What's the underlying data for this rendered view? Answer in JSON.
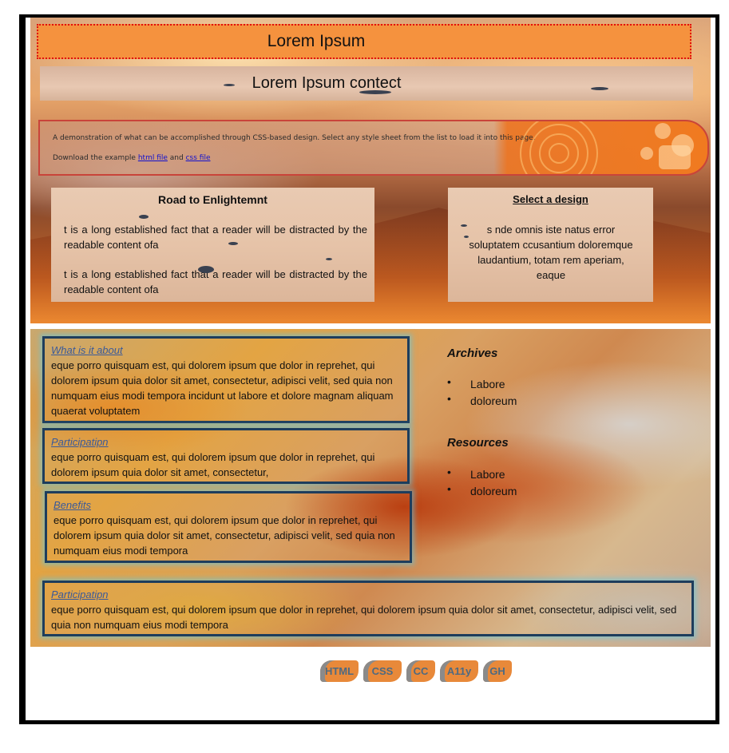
{
  "header": {
    "title": "Lorem Ipsum",
    "subtitle": "Lorem Ipsum contect"
  },
  "demo": {
    "line1": "A demonstration of what can be accomplished through CSS-based design. Select any style sheet from the list to load it into this page.",
    "download_prefix": "Download the example",
    "html_link": "html file",
    "and": "and",
    "css_link": "css file"
  },
  "road": {
    "title": "Road to Enlightemnt",
    "para1": "t is a long established fact that a reader will be distracted by the readable content ofa",
    "para2": "t is a long established fact that a reader will be distracted by the readable content ofa"
  },
  "select": {
    "title": "Select a design",
    "text": "s nde omnis iste natus error soluptatem ccusantium doloremque laudantium, totam rem aperiam, eaque"
  },
  "sections": [
    {
      "heading": "What is it about",
      "text": "eque porro quisquam est, qui dolorem ipsum que dolor in reprehet, qui dolorem ipsum quia dolor sit amet, consectetur, adipisci velit, sed quia non numquam eius modi tempora incidunt ut labore et dolore magnam aliquam quaerat voluptatem"
    },
    {
      "heading": "Participatipn",
      "text": "eque porro quisquam est, qui dolorem ipsum que dolor in reprehet, qui dolorem ipsum quia dolor sit amet, consectetur,"
    },
    {
      "heading": "Benefits",
      "text": "eque porro quisquam est, qui dolorem ipsum que dolor in reprehet, qui dolorem ipsum quia dolor sit amet, consectetur, adipisci velit, sed quia non numquam eius modi tempora"
    },
    {
      "heading": "Participatipn",
      "text": "eque porro quisquam est, qui dolorem ipsum que dolor in reprehet, qui dolorem ipsum quia dolor sit amet, consectetur, adipisci velit, sed quia non numquam eius modi tempora"
    }
  ],
  "archives": {
    "title": "Archives",
    "items": [
      "Labore",
      "doloreum"
    ]
  },
  "resources": {
    "title": "Resources",
    "items": [
      "Labore",
      "doloreum"
    ]
  },
  "badges": [
    "HTML",
    "CSS",
    "CC",
    "A11y",
    "GH"
  ]
}
